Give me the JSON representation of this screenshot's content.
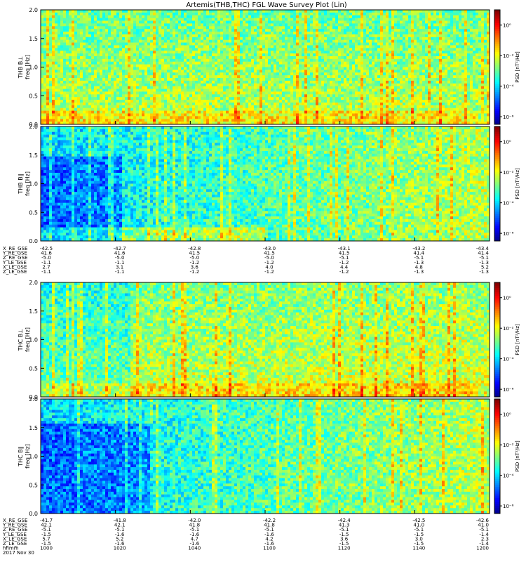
{
  "title": "Artemis(THB,THC) FGL Wave Survey Plot (Lin)",
  "chart_data": [
    {
      "type": "heatmap",
      "probe": "THB",
      "panels": [
        {
          "ylabel": "THB B⊥",
          "ylabel2": "freq [Hz]",
          "clabel": "PSD [nT²/Hz]",
          "ylim": [
            0,
            2
          ],
          "yticks": [
            "0.0",
            "0.5",
            "1.0",
            "1.5",
            "2.0"
          ],
          "cticks": [
            "10⁰",
            "10⁻²",
            "10⁻⁴",
            "10⁻⁶"
          ],
          "crange": [
            -6.5,
            1.0
          ]
        },
        {
          "ylabel": "THB B∥",
          "ylabel2": "freq [Hz]",
          "clabel": "PSD [nT²/Hz]",
          "ylim": [
            0,
            2
          ],
          "yticks": [
            "0.0",
            "0.5",
            "1.0",
            "1.5",
            "2.0"
          ],
          "cticks": [
            "10⁰",
            "10⁻²",
            "10⁻⁴",
            "10⁻⁶"
          ],
          "crange": [
            -6.5,
            1.0
          ]
        }
      ],
      "ephem_labels": [
        "X_RE_GSE",
        "Y_RE_GSE",
        "Z_RE_GSE",
        "Y_LE_GSE",
        "X_LE_GSE",
        "Z_LE_GSE"
      ],
      "ephem_values": [
        [
          "-42.5",
          "-42.7",
          "-42.8",
          "-43.0",
          "-43.1",
          "-43.2",
          "-43.4"
        ],
        [
          "41.6",
          "41.6",
          "41.5",
          "41.5",
          "41.5",
          "41.4",
          "41.4"
        ],
        [
          "-5.0",
          "-5.0",
          "-5.0",
          "-5.0",
          "-5.1",
          "-5.1",
          "-5.1"
        ],
        [
          "-1.1",
          "-1.1",
          "-1.2",
          "-1.2",
          "-1.2",
          "-1.3",
          "-1.3"
        ],
        [
          "2.7",
          "3.1",
          "3.6",
          "4.0",
          "4.4",
          "4.8",
          "5.2"
        ],
        [
          "-1.1",
          "-1.1",
          "-1.2",
          "-1.2",
          "-1.2",
          "-1.3",
          "-1.3"
        ]
      ]
    },
    {
      "type": "heatmap",
      "probe": "THC",
      "panels": [
        {
          "ylabel": "THC B⊥",
          "ylabel2": "freq [Hz]",
          "clabel": "PSD [nT²/Hz]",
          "ylim": [
            0,
            2
          ],
          "yticks": [
            "0.0",
            "0.5",
            "1.0",
            "1.5",
            "2.0"
          ],
          "cticks": [
            "10⁰",
            "10⁻²",
            "10⁻⁴",
            "10⁻⁶"
          ],
          "crange": [
            -6.5,
            1.0
          ]
        },
        {
          "ylabel": "THC B∥",
          "ylabel2": "freq [Hz]",
          "clabel": "PSD [nT²/Hz]",
          "ylim": [
            0,
            2
          ],
          "yticks": [
            "0.0",
            "0.5",
            "1.0",
            "1.5",
            "2.0"
          ],
          "cticks": [
            "10⁰",
            "10⁻²",
            "10⁻⁴",
            "10⁻⁶"
          ],
          "crange": [
            -6.5,
            1.0
          ]
        }
      ],
      "ephem_labels": [
        "X_RE_GSE",
        "Y_RE_GSE",
        "Z_RE_GSE",
        "Y_LE_GSE",
        "X_LE_GSE",
        "Z_LE_GSE",
        "hhmm"
      ],
      "ephem_values": [
        [
          "-41.7",
          "-41.8",
          "-42.0",
          "-42.2",
          "-42.4",
          "-42.5",
          "-42.6"
        ],
        [
          "42.1",
          "42.1",
          "41.8",
          "41.8",
          "41.3",
          "41.0",
          "41.0"
        ],
        [
          "-5.1",
          "-5.1",
          "-5.1",
          "-5.1",
          "-5.1",
          "-5.1",
          "-5.1"
        ],
        [
          "-1.5",
          "-1.6",
          "-1.6",
          "-1.6",
          "-1.5",
          "-1.5",
          "-1.4"
        ],
        [
          "5.7",
          "5.2",
          "4.7",
          "4.2",
          "3.6",
          "3.0",
          "2.3"
        ],
        [
          "-1.5",
          "-1.6",
          "-1.6",
          "-1.6",
          "-1.5",
          "-1.5",
          "-1.4"
        ],
        [
          "1000",
          "1020",
          "1040",
          "1100",
          "1120",
          "1140",
          "1200"
        ]
      ],
      "date": "2017 Nov 30"
    }
  ]
}
